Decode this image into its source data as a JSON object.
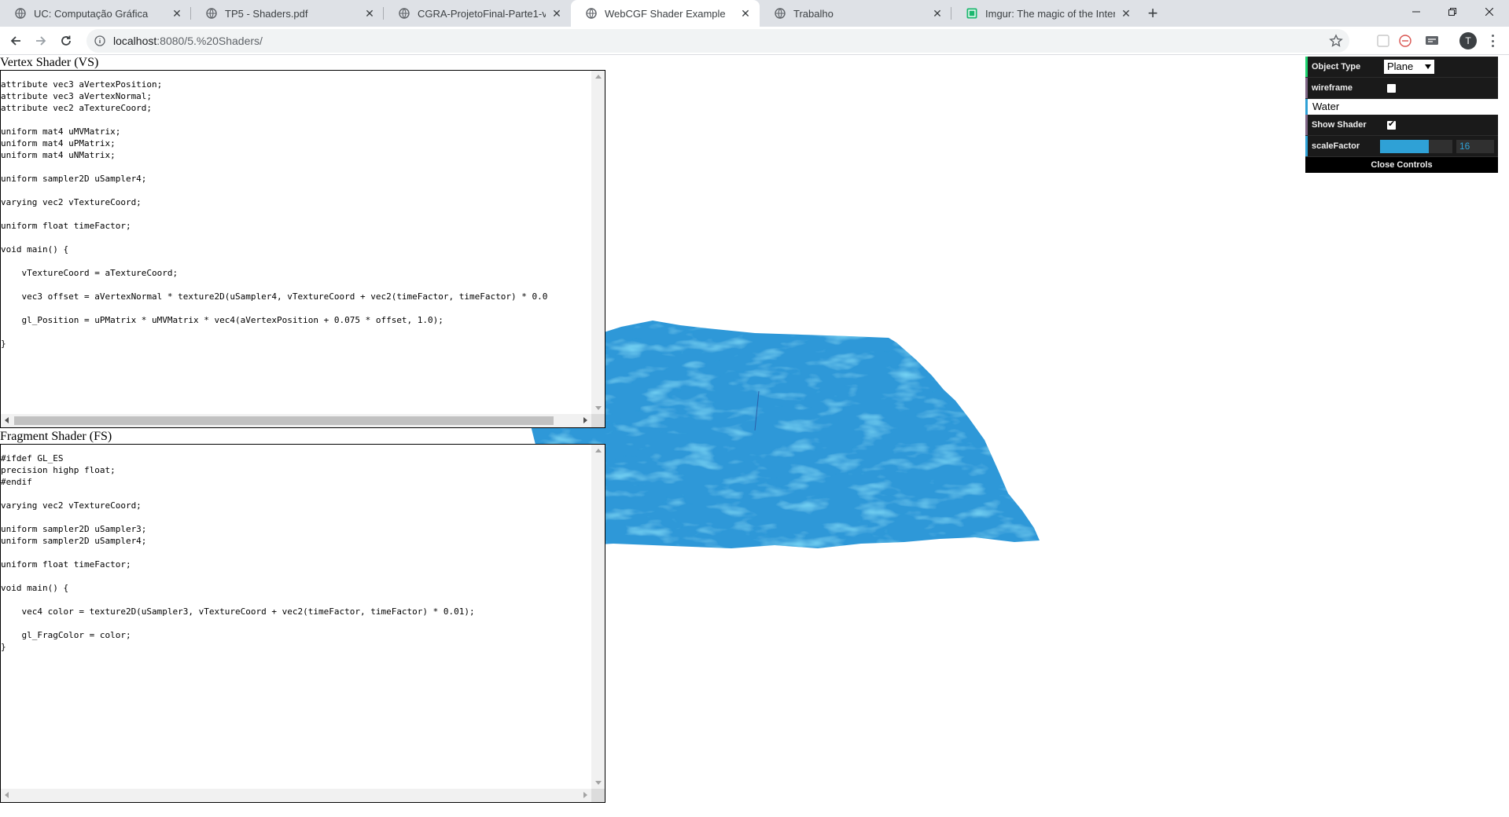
{
  "browser": {
    "tabs": [
      {
        "title": "UC: Computação Gráfica",
        "active": false
      },
      {
        "title": "TP5 - Shaders.pdf",
        "active": false
      },
      {
        "title": "CGRA-ProjetoFinal-Parte1-v1.0.pdf",
        "active": false
      },
      {
        "title": "WebCGF Shader Example",
        "active": true
      },
      {
        "title": "Trabalho",
        "active": false
      },
      {
        "title": "Imgur: The magic of the Internet",
        "active": false
      }
    ],
    "url_host": "localhost",
    "url_rest": ":8080/5.%20Shaders/",
    "avatar_initial": "T"
  },
  "vertex": {
    "heading": "Vertex Shader (VS)",
    "code": "attribute vec3 aVertexPosition;\nattribute vec3 aVertexNormal;\nattribute vec2 aTextureCoord;\n\nuniform mat4 uMVMatrix;\nuniform mat4 uPMatrix;\nuniform mat4 uNMatrix;\n\nuniform sampler2D uSampler4;\n\nvarying vec2 vTextureCoord;\n\nuniform float timeFactor;\n\nvoid main() {\n\n    vTextureCoord = aTextureCoord;\n\n    vec3 offset = aVertexNormal * texture2D(uSampler4, vTextureCoord + vec2(timeFactor, timeFactor) * 0.0\n\n    gl_Position = uPMatrix * uMVMatrix * vec4(aVertexPosition + 0.075 * offset, 1.0);\n\n}"
  },
  "fragment": {
    "heading": "Fragment Shader (FS)",
    "code": "#ifdef GL_ES\nprecision highp float;\n#endif\n\nvarying vec2 vTextureCoord;\n\nuniform sampler2D uSampler3;\nuniform sampler2D uSampler4;\n\nuniform float timeFactor;\n\nvoid main() {\n\n    vec4 color = texture2D(uSampler3, vTextureCoord + vec2(timeFactor, timeFactor) * 0.01);\n\n    gl_FragColor = color;\n}"
  },
  "gui": {
    "object_type_label": "Object Type",
    "object_type_value": "Plane",
    "wireframe_label": "wireframe",
    "wireframe_checked": false,
    "folder_name": "Water",
    "show_shader_label": "Show Shader",
    "show_shader_checked": true,
    "scale_factor_label": "scaleFactor",
    "scale_factor_value": "16",
    "scale_factor_fraction": 0.67,
    "close_label": "Close Controls"
  },
  "colors": {
    "water": "#2e98d8",
    "gui_accent": "#2fa1d6"
  }
}
